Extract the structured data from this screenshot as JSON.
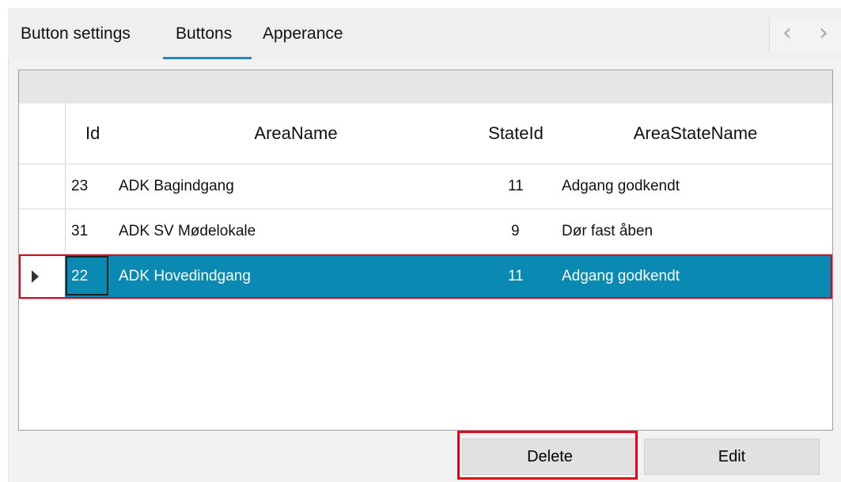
{
  "tabs": [
    {
      "label": "Button settings",
      "selected": false
    },
    {
      "label": "Buttons",
      "selected": true
    },
    {
      "label": "Apperance",
      "selected": false
    }
  ],
  "nav": {
    "prev_icon": "chevron-left-icon",
    "next_icon": "chevron-right-icon",
    "prev_glyph": "‹",
    "next_glyph": "›"
  },
  "grid": {
    "columns": [
      "Id",
      "AreaName",
      "StateId",
      "AreaStateName"
    ],
    "rows": [
      {
        "id": "23",
        "area_name": "ADK Bagindgang",
        "state_id": "11",
        "area_state_name": "Adgang godkendt",
        "selected": false
      },
      {
        "id": "31",
        "area_name": "ADK SV Mødelokale",
        "state_id": "9",
        "area_state_name": "Dør fast åben",
        "selected": false
      },
      {
        "id": "22",
        "area_name": "ADK Hovedindgang",
        "state_id": "11",
        "area_state_name": "Adgang godkendt",
        "selected": true
      }
    ],
    "selected_row_color": "#0a8ab2",
    "highlight_color": "#e4001b"
  },
  "buttons": {
    "delete_label": "Delete",
    "edit_label": "Edit"
  }
}
